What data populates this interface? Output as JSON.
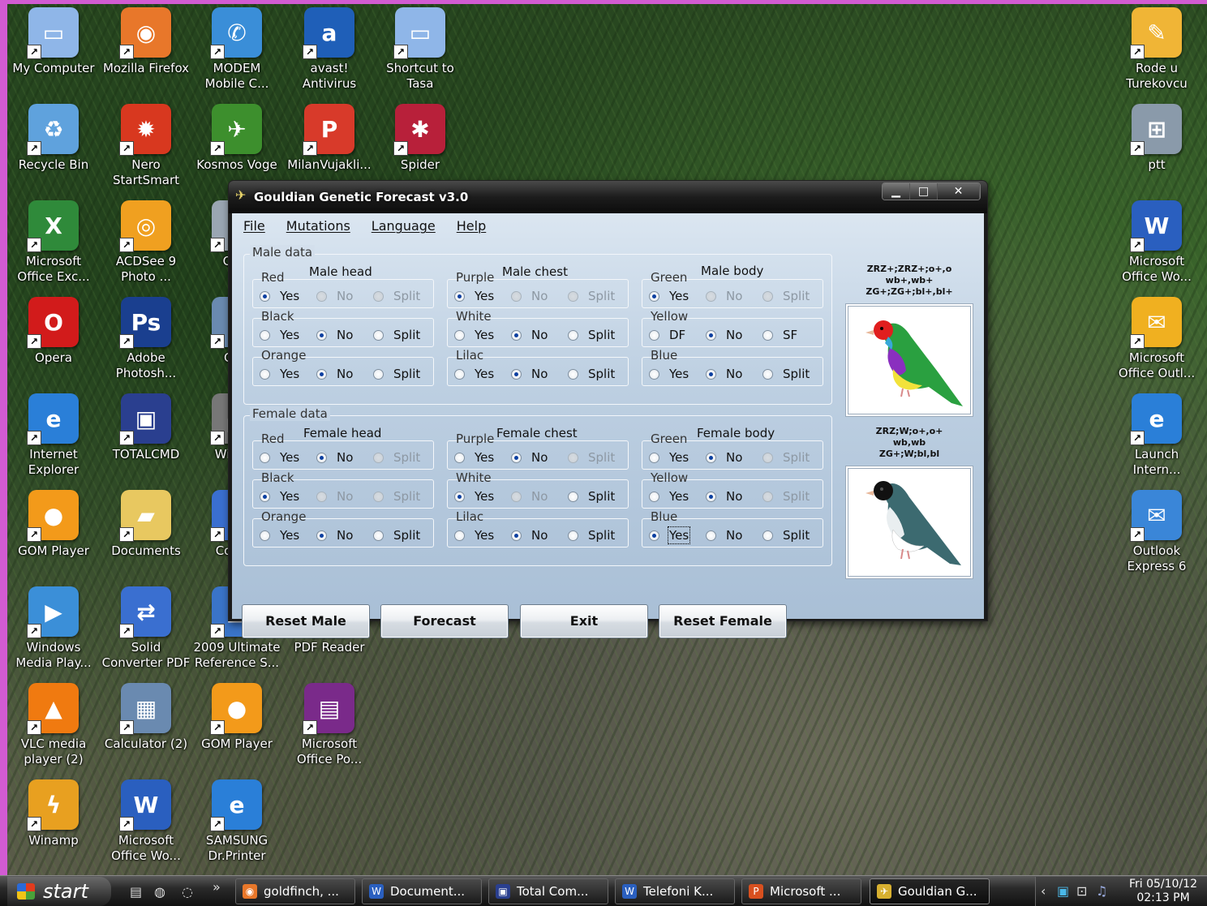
{
  "desktop": {
    "icons": [
      {
        "label": "My Computer",
        "icon": "computer-icon",
        "color": "#8fb6e8"
      },
      {
        "label": "Mozilla Firefox",
        "icon": "firefox-icon",
        "color": "#e8772a"
      },
      {
        "label": "MODEM Mobile C...",
        "icon": "modem-icon",
        "color": "#3a8ed8"
      },
      {
        "label": "avast! Antivirus",
        "icon": "avast-icon",
        "color": "#1f5fb8"
      },
      {
        "label": "Shortcut to Tasa",
        "icon": "computer-icon",
        "color": "#8fb6e8"
      },
      {
        "label": "Rode u Turekovcu",
        "icon": "document-icon",
        "color": "#f0b536"
      },
      {
        "label": "Recycle Bin",
        "icon": "recycle-bin-icon",
        "color": "#5fa2dd"
      },
      {
        "label": "Nero StartSmart",
        "icon": "nero-icon",
        "color": "#d8381f"
      },
      {
        "label": "Kosmos Voge",
        "icon": "bird-icon",
        "color": "#3d8f2d"
      },
      {
        "label": "MilanVujakli...",
        "icon": "pdf-icon",
        "color": "#d83a2a"
      },
      {
        "label": "Spider",
        "icon": "spider-icon",
        "color": "#b8203a"
      },
      {
        "label": "ptt",
        "icon": "network-icon",
        "color": "#8a9aaa"
      },
      {
        "label": "Microsoft Office Exc...",
        "icon": "excel-icon",
        "color": "#2f8a3a"
      },
      {
        "label": "ACDSee 9 Photo ...",
        "icon": "camera-icon",
        "color": "#f0a020"
      },
      {
        "label": "Qu F",
        "icon": "app-icon",
        "color": "#9aa6b2"
      },
      {
        "label": "Microsoft Office Wo...",
        "icon": "word-icon",
        "color": "#2a5fbf"
      },
      {
        "label": "Opera",
        "icon": "opera-icon",
        "color": "#d21b1b"
      },
      {
        "label": "Adobe Photosh...",
        "icon": "photoshop-icon",
        "color": "#1a3f8f"
      },
      {
        "label": "Calc",
        "icon": "calculator-icon",
        "color": "#6a8ab0"
      },
      {
        "label": "Microsoft Office Outl...",
        "icon": "outlook-icon",
        "color": "#f0b020"
      },
      {
        "label": "Internet Explorer",
        "icon": "ie-icon",
        "color": "#2a7fd8"
      },
      {
        "label": "TOTALCMD",
        "icon": "floppy-icon",
        "color": "#2a3f8f"
      },
      {
        "label": "Wi Mov",
        "icon": "film-icon",
        "color": "#777777"
      },
      {
        "label": "Launch Intern...",
        "icon": "ie-icon",
        "color": "#2a7fd8"
      },
      {
        "label": "GOM Player",
        "icon": "gom-icon",
        "color": "#f39a1a"
      },
      {
        "label": "Documents",
        "icon": "folder-icon",
        "color": "#e8c860"
      },
      {
        "label": "Co Sho",
        "icon": "app-icon",
        "color": "#3a6fd0"
      },
      {
        "label": "Outlook Express 6",
        "icon": "mail-icon",
        "color": "#3a86d8"
      },
      {
        "label": "Windows Media Play...",
        "icon": "media-player-icon",
        "color": "#3b8fd8"
      },
      {
        "label": "Solid Converter PDF",
        "icon": "converter-icon",
        "color": "#3a6fd0"
      },
      {
        "label": "2009 Ultimate Reference S...",
        "icon": "book-icon",
        "color": "#3a74c8"
      },
      {
        "label": "PDF Reader",
        "icon": "pdf-icon",
        "color": "#f0c020"
      },
      {
        "label": "VLC media player (2)",
        "icon": "vlc-icon",
        "color": "#f07a10"
      },
      {
        "label": "Calculator (2)",
        "icon": "calculator-icon",
        "color": "#6a8ab0"
      },
      {
        "label": "GOM Player",
        "icon": "gom-icon",
        "color": "#f39a1a"
      },
      {
        "label": "Microsoft Office Po...",
        "icon": "winrar-icon",
        "color": "#7a2a8a"
      },
      {
        "label": "Winamp",
        "icon": "winamp-icon",
        "color": "#e8a020"
      },
      {
        "label": "Microsoft Office Wo...",
        "icon": "word-icon",
        "color": "#2a5fbf"
      },
      {
        "label": "SAMSUNG Dr.Printer",
        "icon": "ie-icon",
        "color": "#2a7fd8"
      }
    ]
  },
  "window": {
    "title": "Gouldian Genetic Forecast v3.0",
    "controls": {
      "minimize": "▁",
      "maximize": "□",
      "close": "✕"
    },
    "menu": [
      "File",
      "Mutations",
      "Language",
      "Help"
    ],
    "male": {
      "section_title": "Male data",
      "head_title": "Male head",
      "chest_title": "Male chest",
      "body_title": "Male body",
      "groups": {
        "red": {
          "name": "Red",
          "opts": [
            "Yes",
            "No",
            "Split"
          ],
          "selected": "Yes"
        },
        "black": {
          "name": "Black",
          "opts": [
            "Yes",
            "No",
            "Split"
          ],
          "selected": "No"
        },
        "orange": {
          "name": "Orange",
          "opts": [
            "Yes",
            "No",
            "Split"
          ],
          "selected": "No"
        },
        "purple": {
          "name": "Purple",
          "opts": [
            "Yes",
            "No",
            "Split"
          ],
          "selected": "Yes"
        },
        "white": {
          "name": "White",
          "opts": [
            "Yes",
            "No",
            "Split"
          ],
          "selected": "No"
        },
        "lilac": {
          "name": "Lilac",
          "opts": [
            "Yes",
            "No",
            "Split"
          ],
          "selected": "No"
        },
        "green": {
          "name": "Green",
          "opts": [
            "Yes",
            "No",
            "Split"
          ],
          "selected": "Yes"
        },
        "yellow": {
          "name": "Yellow",
          "opts": [
            "DF",
            "No",
            "SF"
          ],
          "selected": "No"
        },
        "blue": {
          "name": "Blue",
          "opts": [
            "Yes",
            "No",
            "Split"
          ],
          "selected": "No"
        }
      },
      "genotype": [
        "ZRZ+;ZRZ+;o+,o",
        "wb+,wb+",
        "ZG+;ZG+;bl+,bl+"
      ]
    },
    "female": {
      "section_title": "Female data",
      "head_title": "Female head",
      "chest_title": "Female chest",
      "body_title": "Female body",
      "groups": {
        "red": {
          "name": "Red",
          "opts": [
            "Yes",
            "No",
            "Split"
          ],
          "selected": "No"
        },
        "black": {
          "name": "Black",
          "opts": [
            "Yes",
            "No",
            "Split"
          ],
          "selected": "Yes"
        },
        "orange": {
          "name": "Orange",
          "opts": [
            "Yes",
            "No",
            "Split"
          ],
          "selected": "No"
        },
        "purple": {
          "name": "Purple",
          "opts": [
            "Yes",
            "No",
            "Split"
          ],
          "selected": "No"
        },
        "white": {
          "name": "White",
          "opts": [
            "Yes",
            "No",
            "Split"
          ],
          "selected": "Yes"
        },
        "lilac": {
          "name": "Lilac",
          "opts": [
            "Yes",
            "No",
            "Split"
          ],
          "selected": "No"
        },
        "green": {
          "name": "Green",
          "opts": [
            "Yes",
            "No",
            "Split"
          ],
          "selected": "No"
        },
        "yellow": {
          "name": "Yellow",
          "opts": [
            "Yes",
            "No",
            "Split"
          ],
          "selected": "No"
        },
        "blue": {
          "name": "Blue",
          "opts": [
            "Yes",
            "No",
            "Split"
          ],
          "selected": "Yes"
        }
      },
      "genotype": [
        "ZRZ;W;o+,o+",
        "wb,wb",
        "ZG+;W;bl,bl"
      ]
    },
    "buttons": {
      "reset_male": "Reset Male",
      "forecast": "Forecast",
      "exit": "Exit",
      "reset_female": "Reset Female"
    }
  },
  "taskbar": {
    "start_label": "start",
    "overflow": "»",
    "tasks": [
      {
        "label": "goldfinch, ...",
        "icon": "firefox-icon",
        "color": "#e8772a"
      },
      {
        "label": "Document...",
        "icon": "word-icon",
        "color": "#2a5fbf"
      },
      {
        "label": "Total Com...",
        "icon": "floppy-icon",
        "color": "#2a3f8f"
      },
      {
        "label": "Telefoni K...",
        "icon": "word-icon",
        "color": "#2a5fbf"
      },
      {
        "label": "Microsoft ...",
        "icon": "powerpoint-icon",
        "color": "#d8501f"
      },
      {
        "label": "Gouldian G...",
        "icon": "bird-icon",
        "color": "#d8b030"
      }
    ],
    "clock": {
      "date": "Fri 05/10/12",
      "time": "02:13 PM"
    }
  },
  "colors": {
    "frame": "#d25bd2",
    "radio_dot": "#0b3fa0",
    "client_bg": "#bed0e2"
  }
}
